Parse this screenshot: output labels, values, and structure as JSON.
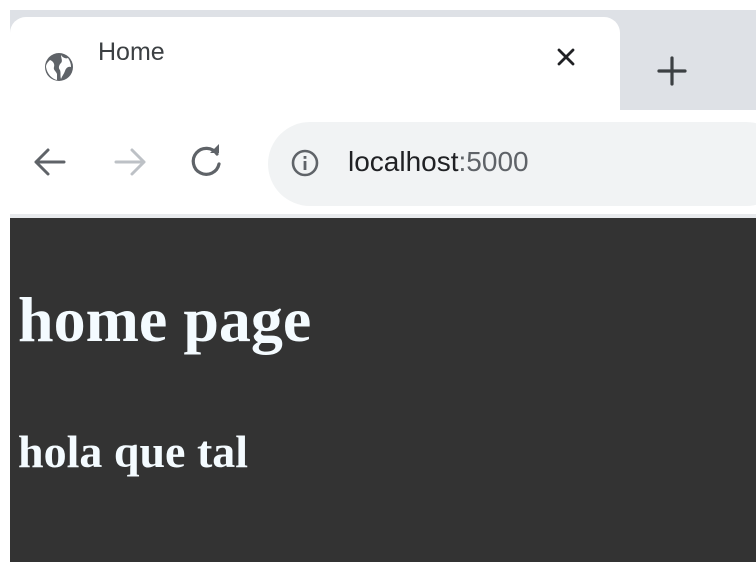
{
  "browser": {
    "tab": {
      "title": "Home",
      "favicon": "globe-icon",
      "close_icon": "close-icon"
    },
    "new_tab_icon": "plus-icon",
    "nav": {
      "back_icon": "back-arrow-icon",
      "forward_icon": "forward-arrow-icon",
      "reload_icon": "reload-icon"
    },
    "omnibox": {
      "info_icon": "info-icon",
      "host": "localhost",
      "port": ":5000"
    }
  },
  "page": {
    "heading": "home page",
    "subheading": "hola que tal",
    "colors": {
      "background": "#333333",
      "text": "#f4fbff"
    }
  },
  "colors": {
    "tabstrip": "#dee1e6",
    "toolbar": "#ffffff",
    "omnibox": "#f1f3f4",
    "icon": "#5f6368",
    "icon_disabled": "#bdc1c6"
  }
}
